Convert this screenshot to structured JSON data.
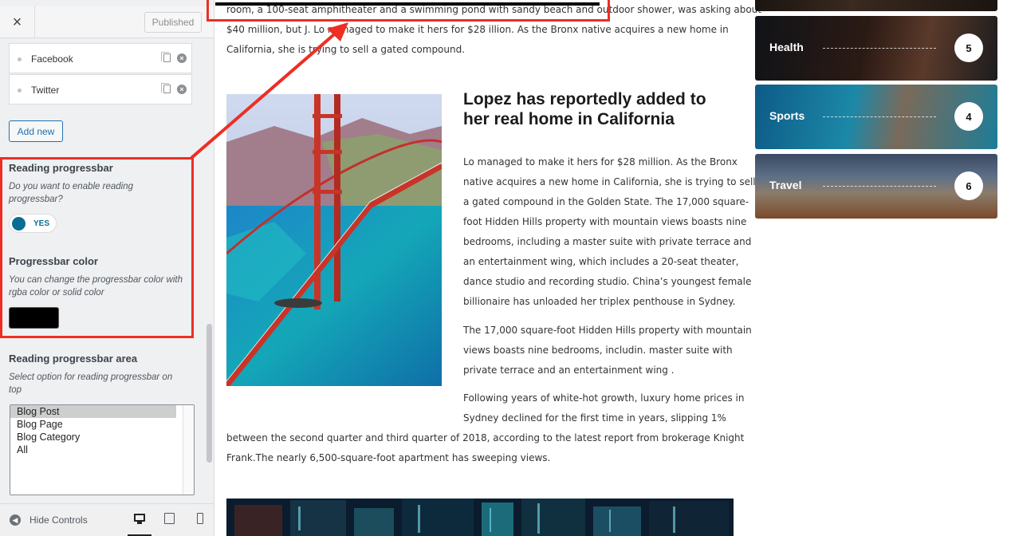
{
  "header": {
    "close_icon": "×",
    "publish_label": "Published"
  },
  "social": {
    "items": [
      {
        "label": "Facebook"
      },
      {
        "label": "Twitter"
      }
    ],
    "add_new_label": "Add new"
  },
  "reading_progressbar": {
    "title": "Reading progressbar",
    "description": "Do you want to enable reading progressbar?",
    "toggle_label": "YES",
    "enabled": true
  },
  "progressbar_color": {
    "title": "Progressbar color",
    "description": "You can change the progressbar color with rgba color or solid color",
    "value": "#000000"
  },
  "progressbar_area": {
    "title": "Reading progressbar area",
    "description": "Select option for reading progressbar on top",
    "options": [
      "Blog Post",
      "Blog Page",
      "Blog Category",
      "All"
    ],
    "selected": "Blog Post"
  },
  "footer": {
    "hide_controls_label": "Hide Controls",
    "devices": [
      "desktop-icon",
      "tablet-icon",
      "mobile-icon"
    ]
  },
  "colors": {
    "highlight": "#ee2e24",
    "accent": "#2271b1",
    "toggle": "#0a6c95"
  },
  "article": {
    "intro_line1": "room, a 100-seat amphitheater and a swimming pond with sandy beach and outdoor shower, was asking about",
    "intro_line2": "$40 million, but J. Lo managed to make it hers for $28 illion. As the Bronx native acquires a new home in",
    "intro_line3": "California, she is trying to sell a gated compound.",
    "title": "Lopez has reportedly added to her real home in California",
    "para1": [
      "Lo managed to make it hers for $28 million. As the Bronx",
      "native acquires a new home in California, she is trying to sell",
      "a gated compound in the Golden State. The 17,000 square-",
      "foot Hidden Hills property with mountain views boasts nine",
      "bedrooms, including a master suite with private terrace and",
      "an entertainment wing, which includes a 20-seat theater,",
      "dance studio and recording studio. China’s youngest female",
      "billionaire has unloaded her triplex penthouse in Sydney."
    ],
    "para2": [
      "The 17,000 square-foot Hidden Hills property with mountain",
      "views boasts nine bedrooms, includin. master suite with",
      "private terrace and an entertainment wing ."
    ],
    "para3": [
      "Following years of white-hot growth, luxury home prices in",
      "Sydney declined for the first time in years, slipping 1%",
      "between the second quarter and third quarter of 2018, according to the latest report from brokerage Knight",
      "Frank.The nearly 6,500-square-foot apartment has sweeping views."
    ]
  },
  "categories": [
    {
      "label": "Health",
      "count": "5"
    },
    {
      "label": "Sports",
      "count": "4"
    },
    {
      "label": "Travel",
      "count": "6"
    }
  ]
}
